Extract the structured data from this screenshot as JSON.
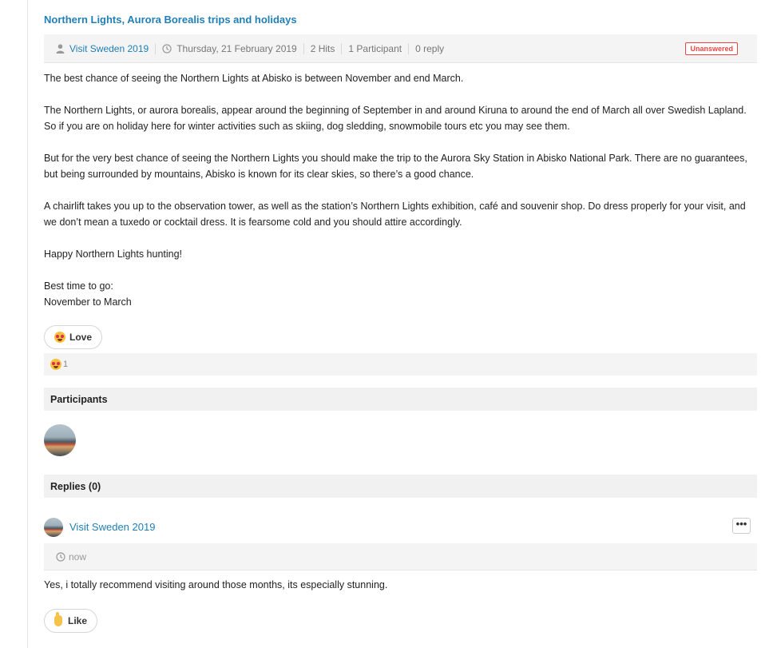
{
  "topic": {
    "title": "Northern Lights, Aurora Borealis trips and holidays",
    "author": "Visit Sweden 2019",
    "date": "Thursday, 21 February 2019",
    "hits": "2 Hits",
    "participants": "1 Participant",
    "replies": "0 reply",
    "status": "Unanswered",
    "body": [
      "The best chance of seeing the Northern Lights at Abisko is between November and end March.",
      "The Northern Lights, or aurora borealis, appear around the beginning of September in and around Kiruna to around the end of March all over Swedish Lapland. So if you are on holiday here for winter activities such as skiing, dog sledding, snowmobile tours etc you may see them.",
      "But for the very best chance of seeing the Northern Lights you should make the trip to the Aurora Sky Station in Abisko National Park. There are no guarantees, but being surrounded by mountains, Abisko is known for its clear skies, so there’s a good chance.",
      "A chairlift takes you up to the observation tower, as well as the station’s Northern Lights exhibition, café and souvenir shop. Do dress properly for your visit, and we don’t mean a tuxedo or cocktail dress. It is fearsome cold and you should attire accordingly.",
      "Happy Northern Lights hunting!"
    ],
    "best_time_label": "Best time to go:",
    "best_time_value": "November to March"
  },
  "reactions": {
    "love_label": "Love",
    "love_count": "1"
  },
  "participants_section": {
    "heading": "Participants"
  },
  "replies_section": {
    "heading": "Replies (0)"
  },
  "reply": {
    "author": "Visit Sweden 2019",
    "menu_label": "•••",
    "time": "now",
    "text": "Yes, i totally recommend visiting around those months, its especially stunning.",
    "like_label": "Like"
  },
  "colors": {
    "link": "#1f7fb6",
    "badge": "#e44444",
    "panel": "#f4f4f4"
  }
}
